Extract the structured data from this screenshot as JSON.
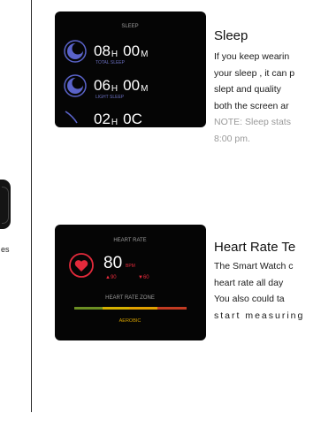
{
  "left_panel": {
    "caption": "es"
  },
  "sleep": {
    "title": "Sleep",
    "lines": [
      "If you keep wearin",
      "your sleep , it can p",
      "slept and quality",
      "both the screen ar"
    ],
    "note": [
      "NOTE: Sleep stats",
      "8:00 pm."
    ],
    "screen": {
      "header": "SLEEP",
      "rows": [
        {
          "hours": "08",
          "h_unit": "H",
          "minutes": "00",
          "m_unit": "M",
          "label": "TOTAL SLEEP"
        },
        {
          "hours": "06",
          "h_unit": "H",
          "minutes": "00",
          "m_unit": "M",
          "label": "LIGHT SLEEP"
        },
        {
          "hours": "02",
          "h_unit": "H",
          "minutes": "0C"
        }
      ]
    }
  },
  "heart_rate": {
    "title": "Heart Rate Te",
    "lines": [
      "The Smart Watch c",
      "heart rate all day",
      "You also could ta"
    ],
    "spaced_line": "start measuring",
    "screen": {
      "header": "HEART RATE",
      "bpm": "80",
      "bpm_unit": "BPM",
      "max_label": "▲90",
      "min_label": "▼60",
      "zone_label": "HEART RATE ZONE",
      "zone_value": "AEROBIC"
    }
  },
  "colors": {
    "sleep_icon": "#5a63c9",
    "heart_icon": "#e32a3b",
    "zone_bar": [
      "#6b8e23",
      "#d4b000",
      "#e0a000",
      "#c23b22"
    ]
  }
}
